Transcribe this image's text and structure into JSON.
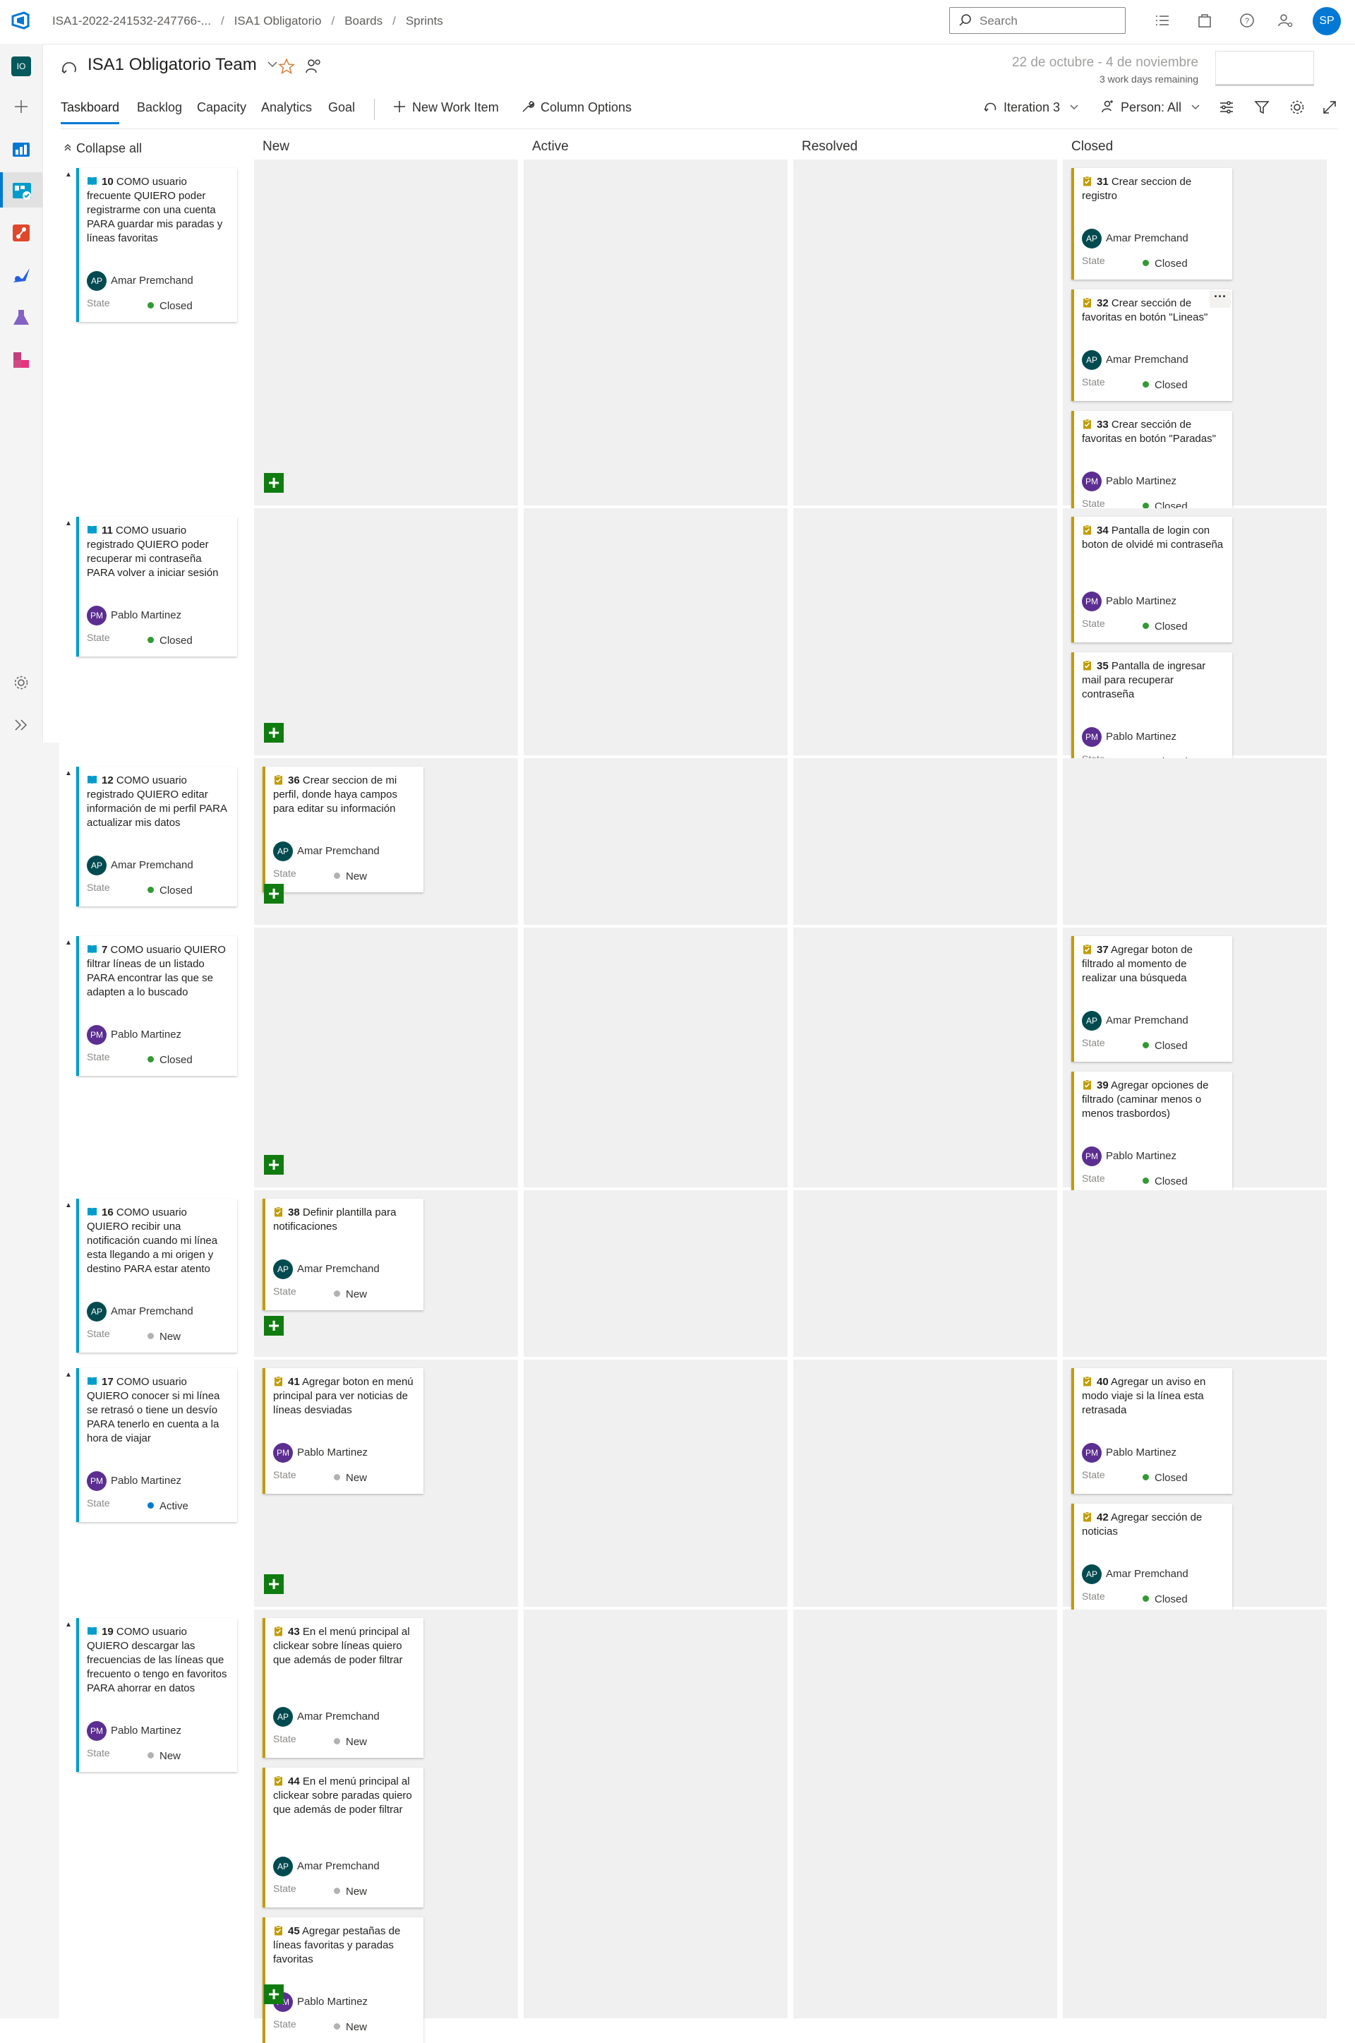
{
  "topbar": {
    "breadcrumbs": [
      "ISA1-2022-241532-247766-...",
      "ISA1 Obligatorio",
      "Boards",
      "Sprints"
    ],
    "search_placeholder": "Search",
    "user_initials": "SP"
  },
  "leftnav": {
    "project_initials": "IO"
  },
  "header": {
    "team_name": "ISA1 Obligatorio Team",
    "sprint_dates": "22 de octubre - 4 de noviembre",
    "sprint_remaining": "3 work days remaining"
  },
  "pivots": [
    "Taskboard",
    "Backlog",
    "Capacity",
    "Analytics",
    "Goal"
  ],
  "commands": {
    "new_work_item": "New Work Item",
    "column_options": "Column Options",
    "iteration": "Iteration 3",
    "person": "Person: All"
  },
  "board": {
    "collapse_all": "Collapse all",
    "columns": [
      "New",
      "Active",
      "Resolved",
      "Closed"
    ],
    "state_label": "State"
  },
  "colors": {
    "accent": "#0078d4",
    "story_bar": "#009ccc",
    "task_bar": "#c19c00",
    "closed": "#339933",
    "new": "#b2b2b2",
    "active": "#007acc",
    "add": "#107c10",
    "avatar_ap": "#004b50",
    "avatar_pm": "#5c2e91"
  },
  "rows": [
    {
      "story": {
        "id": "10",
        "title": "COMO usuario frecuente QUIERO poder registrarme con una cuenta PARA guardar mis paradas y líneas favoritas",
        "assignee": "Amar Premchand",
        "initials": "AP",
        "state": "Closed"
      },
      "tasks": [
        {
          "id": "31",
          "title": "Crear seccion de registro",
          "assignee": "Amar Premchand",
          "initials": "AP",
          "state": "Closed"
        },
        {
          "id": "32",
          "title": "Crear sección de favoritas en botón \"Lineas\"",
          "assignee": "Amar Premchand",
          "initials": "AP",
          "state": "Closed"
        },
        {
          "id": "33",
          "title": "Crear sección de favoritas en botón \"Paradas\"",
          "assignee": "Pablo Martinez",
          "initials": "PM",
          "state": "Closed"
        }
      ]
    },
    {
      "story": {
        "id": "11",
        "title": "COMO usuario registrado  QUIERO poder recuperar mi contraseña PARA volver a iniciar sesión",
        "assignee": "Pablo Martinez",
        "initials": "PM",
        "state": "Closed"
      },
      "tasks": [
        {
          "id": "34",
          "title": "Pantalla de login con boton de olvidé mi contraseña",
          "assignee": "Pablo Martinez",
          "initials": "PM",
          "state": "Closed"
        },
        {
          "id": "35",
          "title": "Pantalla de ingresar mail para recuperar contraseña",
          "assignee": "Pablo Martinez",
          "initials": "PM",
          "state": "Closed"
        }
      ]
    },
    {
      "story": {
        "id": "12",
        "title": "COMO usuario registrado  QUIERO editar información de mi perfil  PARA actualizar mis datos",
        "assignee": "Amar Premchand",
        "initials": "AP",
        "state": "Closed"
      },
      "tasks": [
        {
          "id": "36",
          "title": "Crear seccion de mi perfil, donde haya campos para editar su información",
          "assignee": "Amar Premchand",
          "initials": "AP",
          "state": "New"
        }
      ]
    },
    {
      "story": {
        "id": "7",
        "title": "COMO usuario QUIERO filtrar líneas de un listado PARA encontrar las que se adapten a lo buscado",
        "assignee": "Pablo Martinez",
        "initials": "PM",
        "state": "Closed"
      },
      "tasks": [
        {
          "id": "37",
          "title": "Agregar boton de filtrado al momento de realizar una búsqueda",
          "assignee": "Amar Premchand",
          "initials": "AP",
          "state": "Closed"
        },
        {
          "id": "39",
          "title": "Agregar opciones de filtrado (caminar menos o menos trasbordos)",
          "assignee": "Pablo Martinez",
          "initials": "PM",
          "state": "Closed"
        }
      ]
    },
    {
      "story": {
        "id": "16",
        "title": "COMO usuario QUIERO recibir una notificación cuando mi línea esta llegando a mi origen y destino PARA estar atento",
        "assignee": "Amar Premchand",
        "initials": "AP",
        "state": "New"
      },
      "tasks": [
        {
          "id": "38",
          "title": "Definir plantilla para notificaciones",
          "assignee": "Amar Premchand",
          "initials": "AP",
          "state": "New"
        }
      ]
    },
    {
      "story": {
        "id": "17",
        "title": "COMO usuario QUIERO conocer si mi línea se retrasó o tiene un desvío PARA tenerlo en cuenta a la hora de viajar",
        "assignee": "Pablo Martinez",
        "initials": "PM",
        "state": "Active"
      },
      "tasks": [
        {
          "id": "41",
          "title": "Agregar boton en menú principal para ver noticias de líneas desviadas",
          "assignee": "Pablo Martinez",
          "initials": "PM",
          "state": "New"
        },
        {
          "id": "40",
          "title": "Agregar un aviso en modo viaje si la línea esta retrasada",
          "assignee": "Pablo Martinez",
          "initials": "PM",
          "state": "Closed"
        },
        {
          "id": "42",
          "title": "Agregar sección de noticias",
          "assignee": "Amar Premchand",
          "initials": "AP",
          "state": "Closed"
        }
      ]
    },
    {
      "story": {
        "id": "19",
        "title": "COMO usuario QUIERO descargar las frecuencias de las líneas que frecuento o tengo en favoritos  PARA ahorrar en datos",
        "assignee": "Pablo Martinez",
        "initials": "PM",
        "state": "New"
      },
      "tasks": [
        {
          "id": "43",
          "title": "En el menú principal al clickear sobre líneas quiero que además de poder filtrar",
          "assignee": "Amar Premchand",
          "initials": "AP",
          "state": "New"
        },
        {
          "id": "44",
          "title": "En el menú principal al clickear sobre paradas quiero que además de poder filtrar",
          "assignee": "Amar Premchand",
          "initials": "AP",
          "state": "New"
        },
        {
          "id": "45",
          "title": "Agregar pestañas de líneas favoritas y paradas favoritas",
          "assignee": "Pablo Martinez",
          "initials": "PM",
          "state": "New"
        }
      ]
    }
  ]
}
